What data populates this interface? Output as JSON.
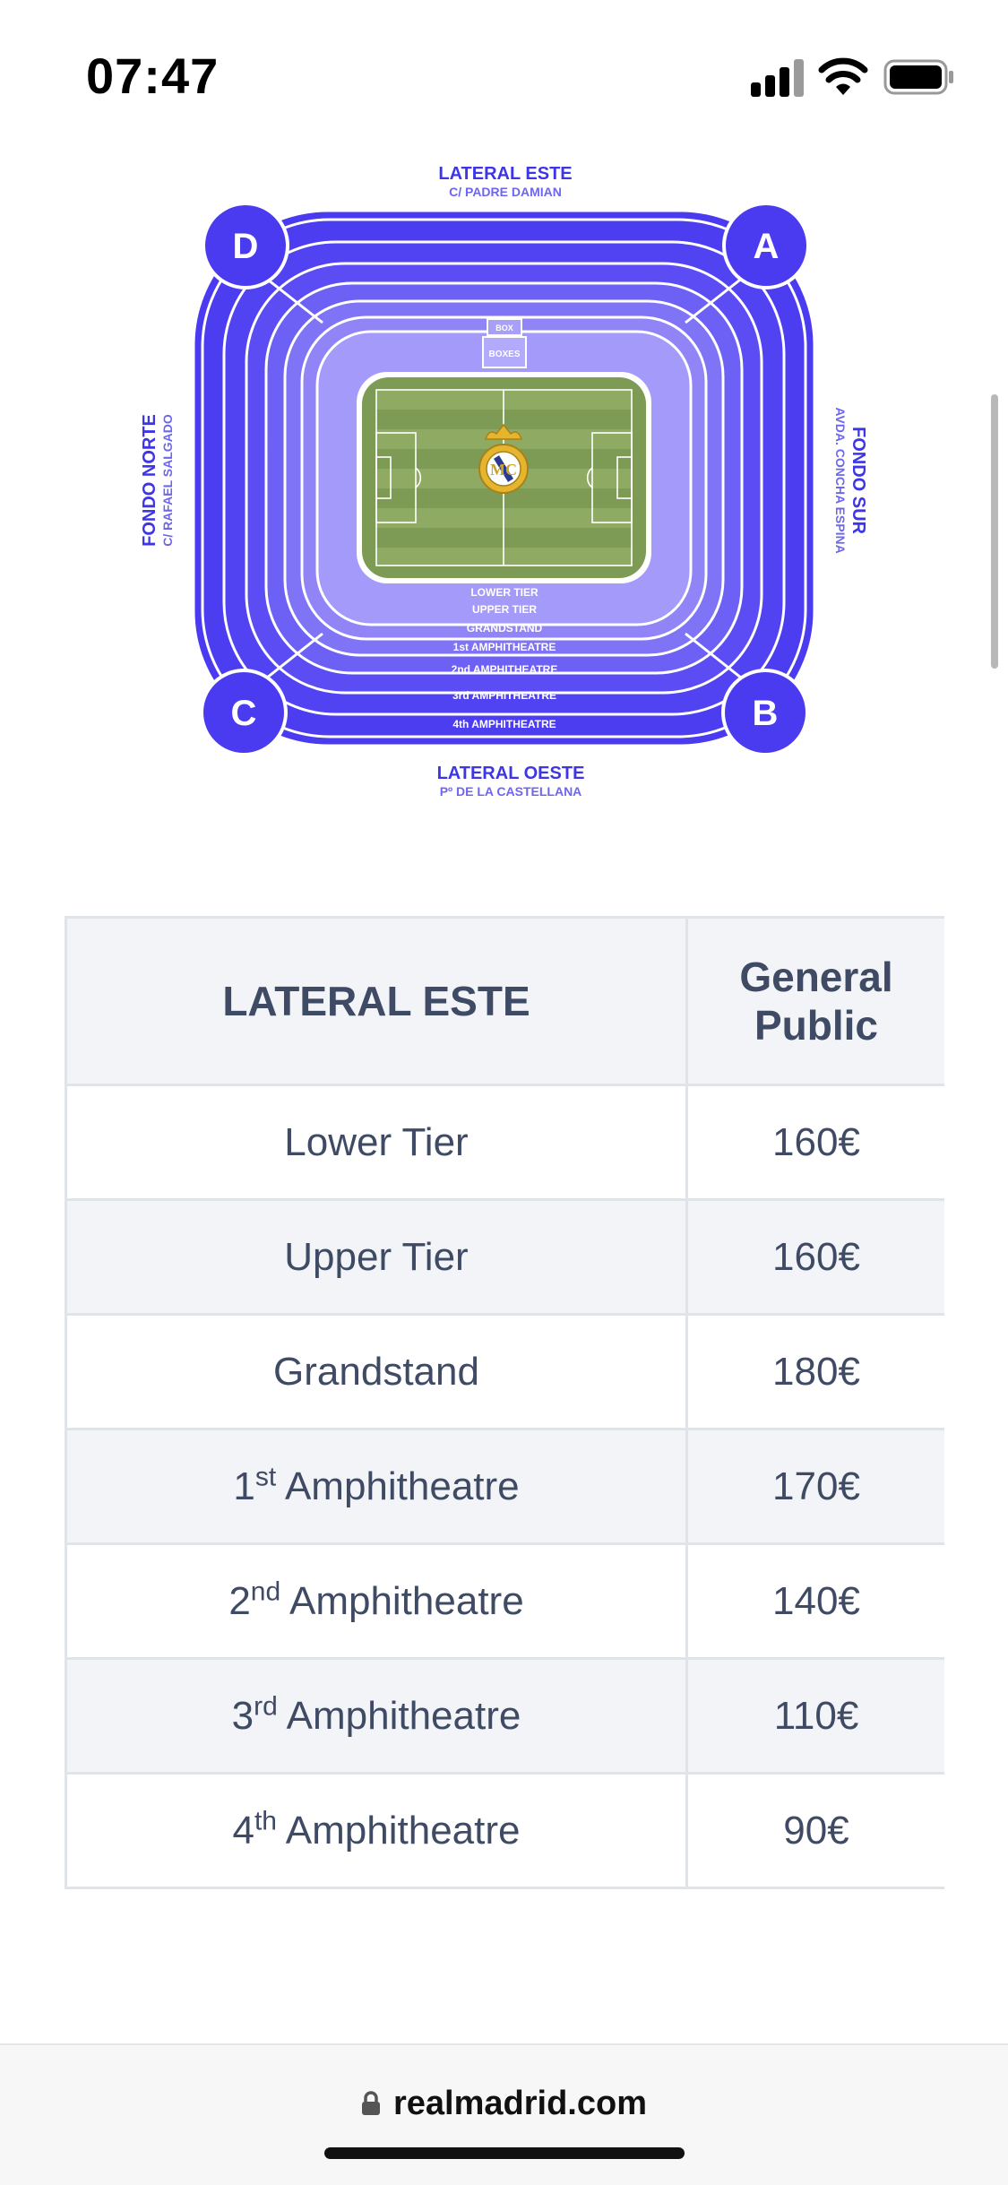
{
  "status_bar": {
    "time": "07:47"
  },
  "stadium_map": {
    "stands": {
      "top": {
        "name": "LATERAL ESTE",
        "street": "C/ PADRE DAMIAN"
      },
      "bottom": {
        "name": "LATERAL OESTE",
        "street": "Pº DE LA CASTELLANA"
      },
      "left": {
        "name": "FONDO NORTE",
        "street": "C/ RAFAEL SALGADO"
      },
      "right": {
        "name": "FONDO SUR",
        "street": "AVDA. CONCHA ESPINA"
      }
    },
    "gates": [
      "D",
      "A",
      "C",
      "B"
    ],
    "tiers": [
      "LOWER TIER",
      "UPPER TIER",
      "GRANDSTAND",
      "1st AMPHITHEATRE",
      "2nd AMPHITHEATRE",
      "3rd AMPHITHEATRE",
      "4th AMPHITHEATRE"
    ],
    "box_labels": [
      "BOX",
      "BOXES"
    ],
    "colors": {
      "stand": "#4a3af0",
      "pitch": "#7d9b55",
      "pitch_light": "#8fab63"
    }
  },
  "price_table": {
    "headers": [
      "LATERAL ESTE",
      "General Public"
    ],
    "rows": [
      {
        "base": "Lower Tier",
        "sup": "",
        "rest": "",
        "price": "160€"
      },
      {
        "base": "Upper Tier",
        "sup": "",
        "rest": "",
        "price": "160€"
      },
      {
        "base": "Grandstand",
        "sup": "",
        "rest": "",
        "price": "180€"
      },
      {
        "base": "1",
        "sup": "st",
        "rest": " Amphitheatre",
        "price": "170€"
      },
      {
        "base": "2",
        "sup": "nd",
        "rest": " Amphitheatre",
        "price": "140€"
      },
      {
        "base": "3",
        "sup": "rd",
        "rest": " Amphitheatre",
        "price": "110€"
      },
      {
        "base": "4",
        "sup": "th",
        "rest": " Amphitheatre",
        "price": "90€"
      }
    ]
  },
  "browser": {
    "url": "realmadrid.com",
    "icon": "lock-icon"
  }
}
